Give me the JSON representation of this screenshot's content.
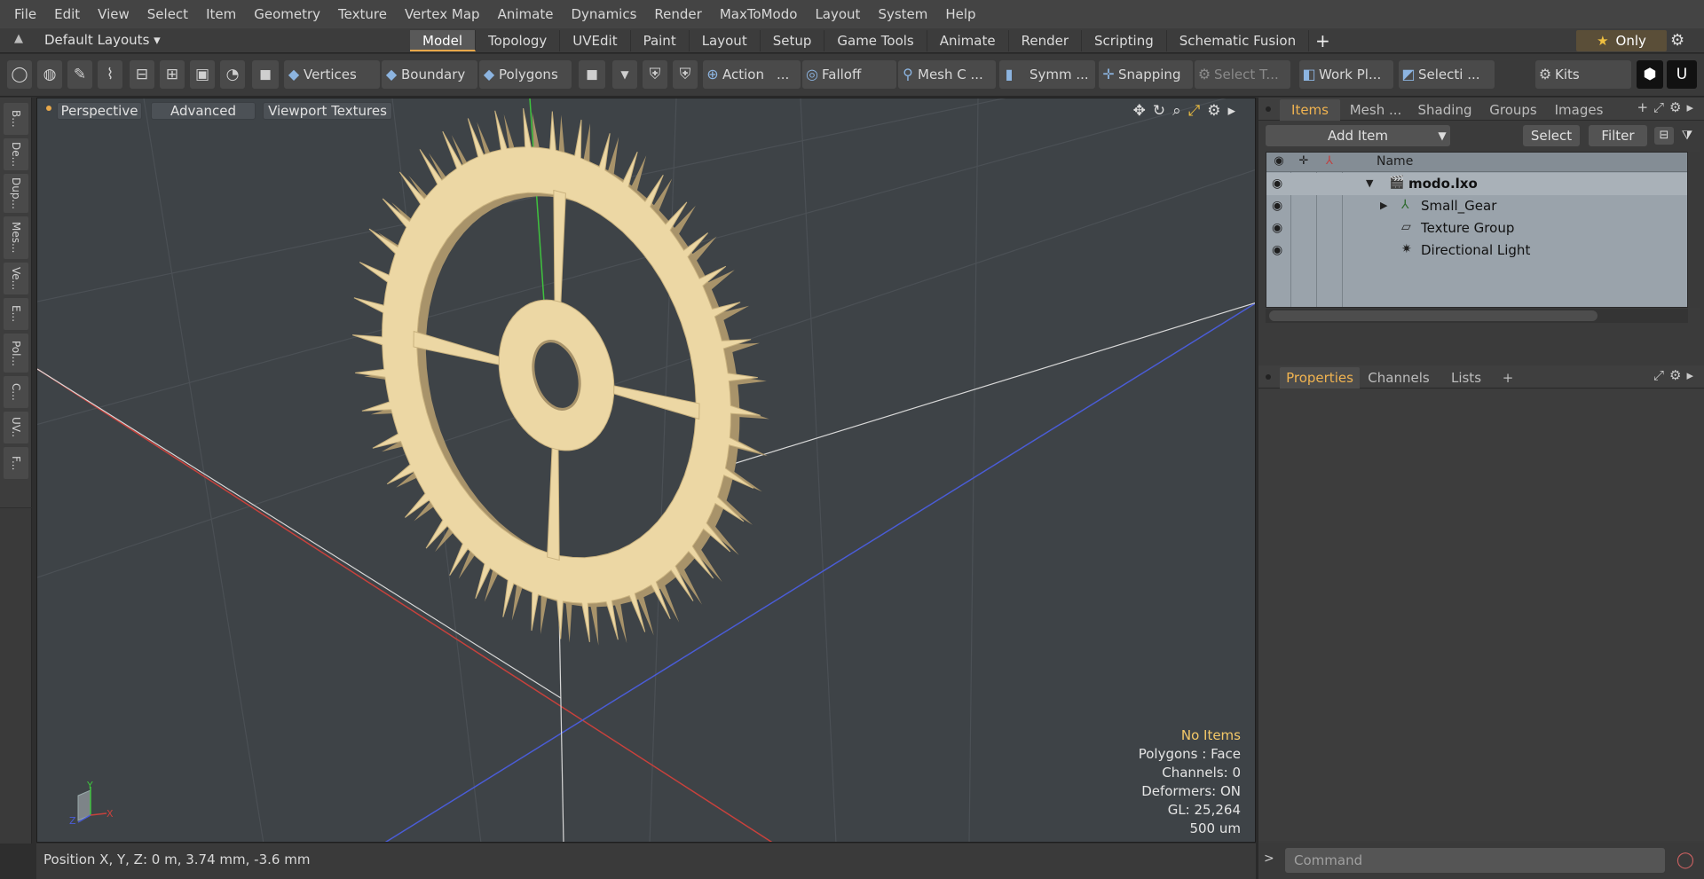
{
  "menu": [
    "File",
    "Edit",
    "View",
    "Select",
    "Item",
    "Geometry",
    "Texture",
    "Vertex Map",
    "Animate",
    "Dynamics",
    "Render",
    "MaxToModo",
    "Layout",
    "System",
    "Help"
  ],
  "layout_select": "Default Layouts ▾",
  "layout_tabs": [
    "Model",
    "Topology",
    "UVEdit",
    "Paint",
    "Layout",
    "Setup",
    "Game Tools",
    "Animate",
    "Render",
    "Scripting",
    "Schematic Fusion"
  ],
  "active_layout_tab": "Model",
  "only_label": "Only",
  "toolbar": {
    "vertices": "Vertices",
    "boundary": "Boundary",
    "polygons": "Polygons",
    "action": "Action",
    "action_more": "...",
    "falloff": "Falloff",
    "mesh_c": "Mesh C ...",
    "symm": "Symm ...",
    "snapping": "Snapping",
    "select_t": "Select T...",
    "work_pl": "Work Pl...",
    "selecti": "Selecti ...",
    "kits": "Kits"
  },
  "left_tools": [
    "B...",
    "De...",
    "Dup...",
    "Mes...",
    "Ve...",
    "E...",
    "Pol...",
    "C...",
    "UV..",
    "F..."
  ],
  "viewport": {
    "view_mode": "Perspective",
    "shading": "Advanced",
    "textures": "Viewport Textures",
    "info": {
      "selection": "No Items",
      "polygons": "Polygons : Face",
      "channels": "Channels: 0",
      "deformers": "Deformers: ON",
      "gl": "GL: 25,264",
      "scale": "500 um"
    },
    "axis_labels": {
      "x": "X",
      "y": "Y",
      "z": "Z"
    },
    "gear_color": "#ecd7a4"
  },
  "status": {
    "position": "Position X, Y, Z:   0 m, 3.74 mm, -3.6 mm"
  },
  "items_panel": {
    "tabs": [
      "Items",
      "Mesh ...",
      "Shading",
      "Groups",
      "Images"
    ],
    "active_tab": "Items",
    "add_item": "Add Item",
    "select": "Select",
    "filter": "Filter",
    "column_name": "Name",
    "tree": [
      {
        "name": "modo.lxo",
        "bold": true
      },
      {
        "name": "Small_Gear",
        "bold": false
      },
      {
        "name": "Texture Group",
        "bold": false
      },
      {
        "name": "Directional Light",
        "bold": false
      }
    ]
  },
  "properties_panel": {
    "tabs": [
      "Properties",
      "Channels",
      "Lists"
    ],
    "active_tab": "Properties"
  },
  "command": {
    "placeholder": "Command"
  },
  "colors": {
    "accent": "#e8a84a",
    "viewport_bg": "#3e4347",
    "x_axis": "#c8413c",
    "y_axis": "#3ec23e",
    "z_axis": "#4a5cd6"
  }
}
